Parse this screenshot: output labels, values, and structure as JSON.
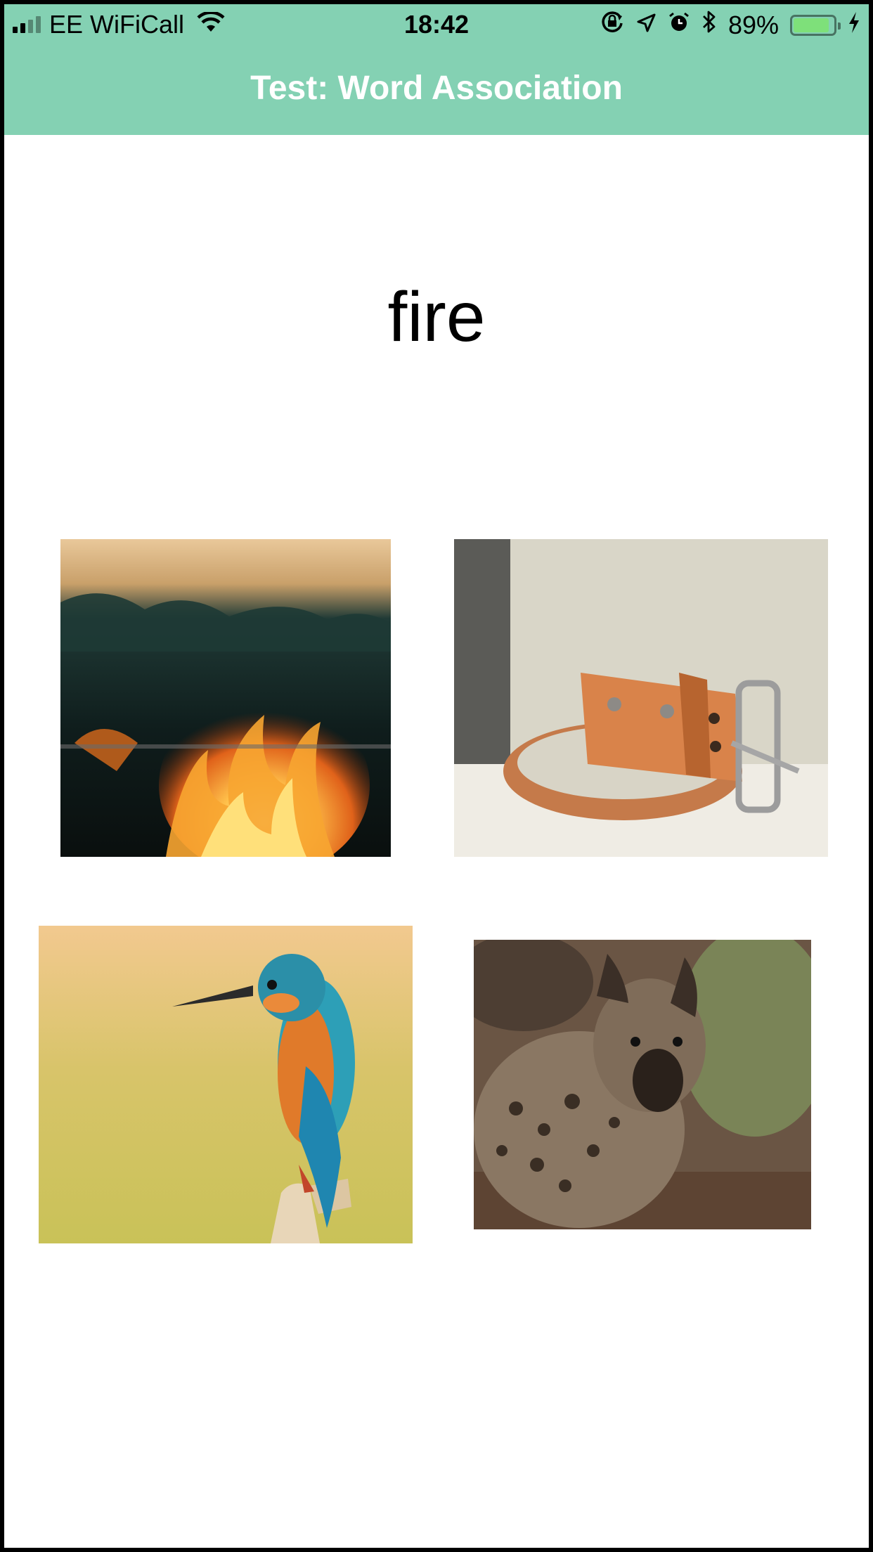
{
  "status_bar": {
    "carrier": "EE WiFiCall",
    "time": "18:42",
    "battery_percent": "89%",
    "battery_level": 0.89,
    "icons": [
      "signal-bars-icon",
      "wifi-icon",
      "orientation-lock-icon",
      "location-arrow-icon",
      "alarm-icon",
      "bluetooth-icon",
      "battery-icon",
      "charging-bolt-icon"
    ]
  },
  "header": {
    "title": "Test: Word Association",
    "background_color": "#84d1b3"
  },
  "prompt_word": "fire",
  "choices": [
    {
      "subject": "fire"
    },
    {
      "subject": "leather belt"
    },
    {
      "subject": "kingfisher bird"
    },
    {
      "subject": "hyena"
    }
  ]
}
